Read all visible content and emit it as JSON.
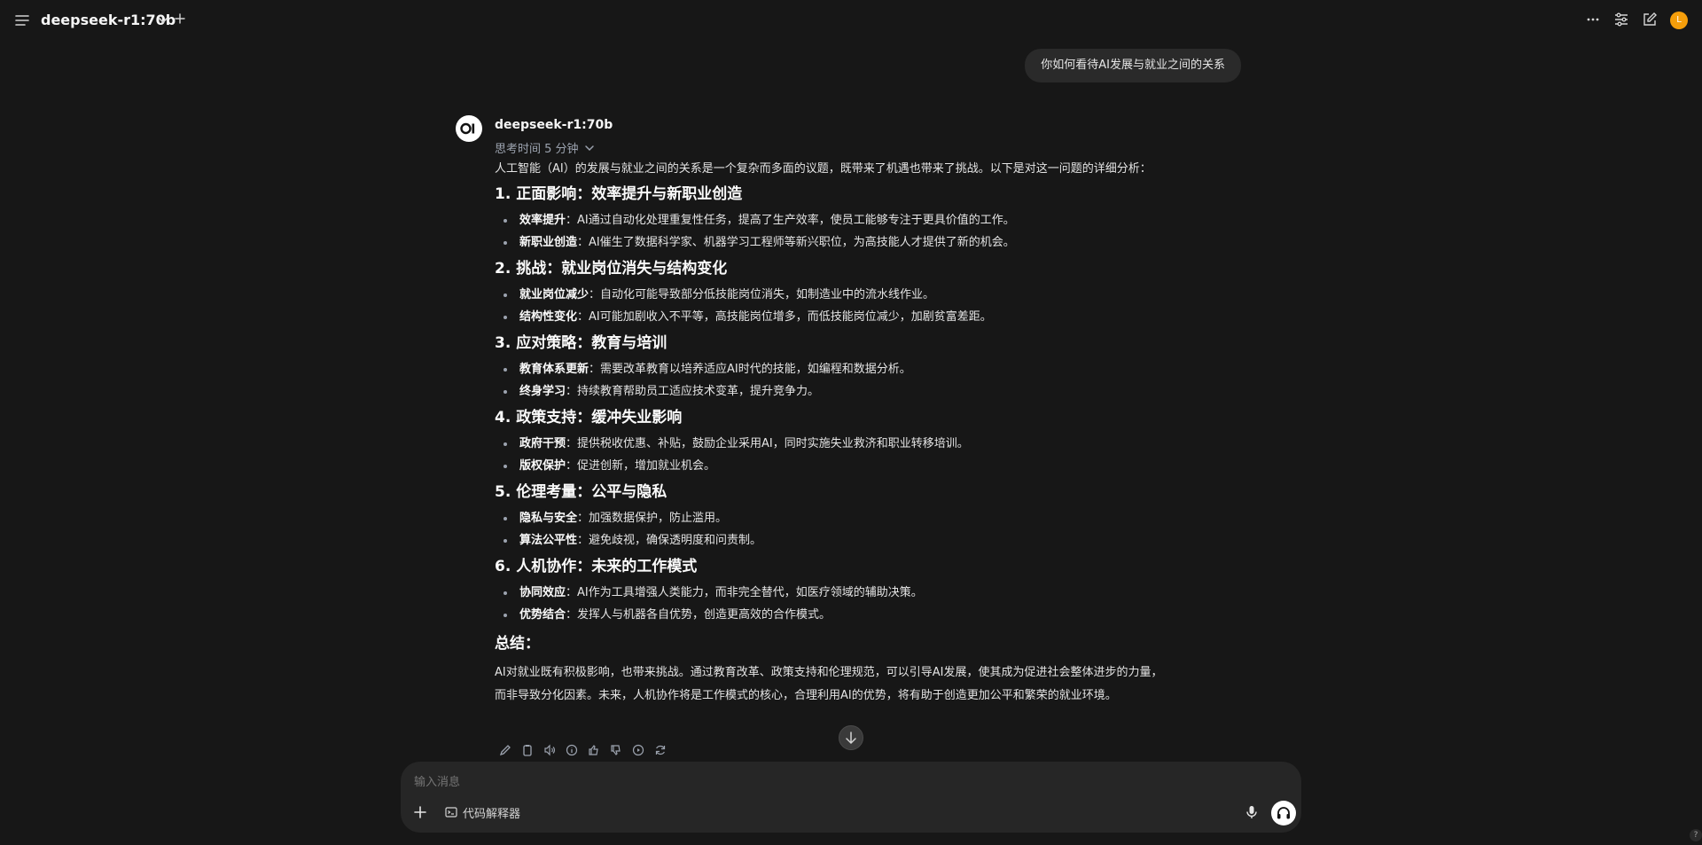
{
  "topbar": {
    "model_name": "deepseek-r1:70b",
    "avatar_letter": "L"
  },
  "chat": {
    "user_message": "你如何看待AI发展与就业之间的关系",
    "assistant": {
      "model": "deepseek-r1:70b",
      "thinking_label": "思考时间 5 分钟",
      "intro": "人工智能（AI）的发展与就业之间的关系是一个复杂而多面的议题，既带来了机遇也带来了挑战。以下是对这一问题的详细分析：",
      "sections": [
        {
          "title": "1. 正面影响：效率提升与新职业创造",
          "items": [
            {
              "term": "效率提升",
              "text": "：AI通过自动化处理重复性任务，提高了生产效率，使员工能够专注于更具价值的工作。"
            },
            {
              "term": "新职业创造",
              "text": "：AI催生了数据科学家、机器学习工程师等新兴职位，为高技能人才提供了新的机会。"
            }
          ]
        },
        {
          "title": "2. 挑战：就业岗位消失与结构变化",
          "items": [
            {
              "term": "就业岗位减少",
              "text": "：自动化可能导致部分低技能岗位消失，如制造业中的流水线作业。"
            },
            {
              "term": "结构性变化",
              "text": "：AI可能加剧收入不平等，高技能岗位增多，而低技能岗位减少，加剧贫富差距。"
            }
          ]
        },
        {
          "title": "3. 应对策略：教育与培训",
          "items": [
            {
              "term": "教育体系更新",
              "text": "：需要改革教育以培养适应AI时代的技能，如编程和数据分析。"
            },
            {
              "term": "终身学习",
              "text": "：持续教育帮助员工适应技术变革，提升竞争力。"
            }
          ]
        },
        {
          "title": "4. 政策支持：缓冲失业影响",
          "items": [
            {
              "term": "政府干预",
              "text": "：提供税收优惠、补贴，鼓励企业采用AI，同时实施失业救济和职业转移培训。"
            },
            {
              "term": "版权保护",
              "text": "：促进创新，增加就业机会。"
            }
          ]
        },
        {
          "title": "5. 伦理考量：公平与隐私",
          "items": [
            {
              "term": "隐私与安全",
              "text": "：加强数据保护，防止滥用。"
            },
            {
              "term": "算法公平性",
              "text": "：避免歧视，确保透明度和问责制。"
            }
          ]
        },
        {
          "title": "6. 人机协作：未来的工作模式",
          "items": [
            {
              "term": "协同效应",
              "text": "：AI作为工具增强人类能力，而非完全替代，如医疗领域的辅助决策。"
            },
            {
              "term": "优势结合",
              "text": "：发挥人与机器各自优势，创造更高效的合作模式。"
            }
          ]
        }
      ],
      "summary_title": "总结：",
      "summary_line1": "AI对就业既有积极影响，也带来挑战。通过教育改革、政策支持和伦理规范，可以引导AI发展，使其成为促进社会整体进步的力量，",
      "summary_line2": "而非导致分化因素。未来，人机协作将是工作模式的核心，合理利用AI的优势，将有助于创造更加公平和繁荣的就业环境。"
    }
  },
  "composer": {
    "placeholder": "输入消息",
    "code_tool_label": "代码解释器"
  },
  "help_label": "?"
}
